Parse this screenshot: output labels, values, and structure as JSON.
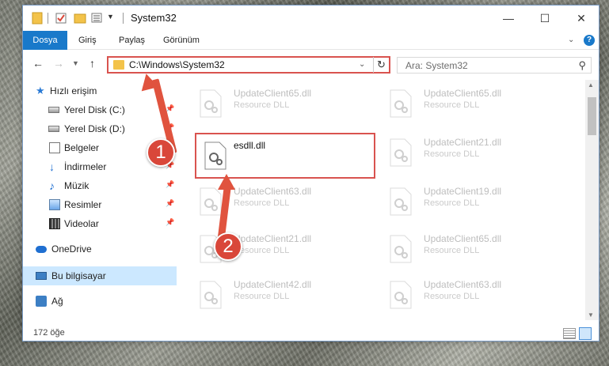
{
  "window": {
    "title": "System32",
    "minimize_glyph": "—",
    "maximize_glyph": "☐",
    "close_glyph": "✕"
  },
  "ribbon": {
    "tabs": [
      "Dosya",
      "Giriş",
      "Paylaş",
      "Görünüm"
    ],
    "help_glyph": "?"
  },
  "nav": {
    "address": "C:\\Windows\\System32",
    "search_placeholder": "Ara: System32"
  },
  "sidebar": {
    "items": [
      {
        "label": "Hızlı erişim",
        "icon": "star-icon"
      },
      {
        "label": "Yerel Disk (C:)",
        "icon": "drive-icon",
        "pinned": true
      },
      {
        "label": "Yerel Disk (D:)",
        "icon": "drive-icon",
        "pinned": true
      },
      {
        "label": "Belgeler",
        "icon": "document-icon",
        "pinned": true
      },
      {
        "label": "İndirmeler",
        "icon": "download-icon",
        "pinned": true
      },
      {
        "label": "Müzik",
        "icon": "music-icon",
        "pinned": true
      },
      {
        "label": "Resimler",
        "icon": "pictures-icon",
        "pinned": true
      },
      {
        "label": "Videolar",
        "icon": "video-icon",
        "pinned": true
      },
      {
        "label": "OneDrive",
        "icon": "cloud-icon"
      },
      {
        "label": "Bu bilgisayar",
        "icon": "computer-icon",
        "selected": true
      },
      {
        "label": "Ağ",
        "icon": "network-icon"
      }
    ]
  },
  "files": {
    "left": [
      {
        "name": "UpdateClient65.dll",
        "type": "Resource DLL"
      },
      {
        "name": "esdll.dll",
        "type": ""
      },
      {
        "name": "UpdateClient63.dll",
        "type": "Resource DLL"
      },
      {
        "name": "UpdateClient21.dll",
        "type": "Resource DLL"
      },
      {
        "name": "UpdateClient42.dll",
        "type": "Resource DLL"
      }
    ],
    "right": [
      {
        "name": "UpdateClient65.dll",
        "type": "Resource DLL"
      },
      {
        "name": "UpdateClient21.dll",
        "type": "Resource DLL"
      },
      {
        "name": "UpdateClient19.dll",
        "type": "Resource DLL"
      },
      {
        "name": "UpdateClient65.dll",
        "type": "Resource DLL"
      },
      {
        "name": "UpdateClient63.dll",
        "type": "Resource DLL"
      }
    ]
  },
  "status": {
    "item_count": "172 öğe"
  },
  "callouts": [
    "1",
    "2"
  ],
  "colors": {
    "accent": "#1979ca",
    "highlight_box": "#d9534f",
    "callout": "#e0533e",
    "selection": "#cce8ff"
  }
}
